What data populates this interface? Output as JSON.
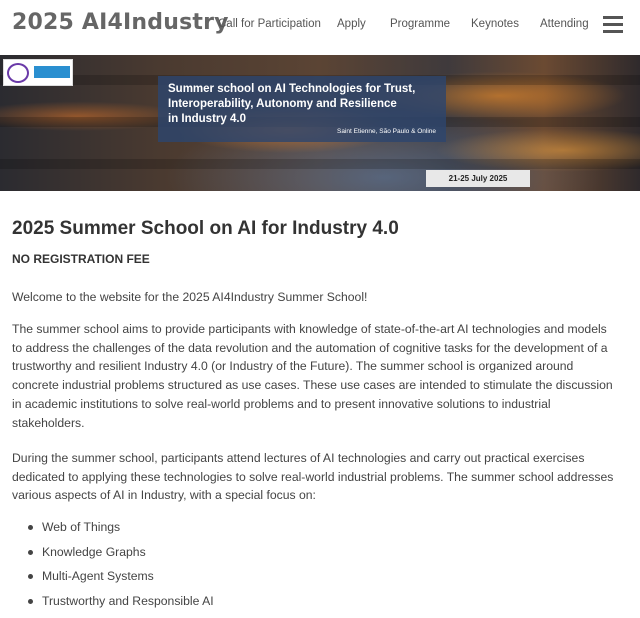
{
  "header": {
    "site_title": "2025 AI4Industry",
    "nav": [
      {
        "label": "Call for Participation"
      },
      {
        "label": "Apply"
      },
      {
        "label": "Programme"
      },
      {
        "label": "Keynotes"
      },
      {
        "label": "Attending"
      }
    ],
    "menu_icon": "hamburger-menu-icon"
  },
  "banner": {
    "title_lines": [
      "Summer school on AI Technologies for Trust,",
      "Interoperability, Autonomy and Resilience",
      "in Industry 4.0"
    ],
    "locations": "Saint Etienne, São Paulo & Online",
    "dates": "21-25 July 2025"
  },
  "main": {
    "title": "2025 Summer School on AI for Industry 4.0",
    "fee_notice": "NO REGISTRATION FEE",
    "welcome": "Welcome to the website for the 2025 AI4Industry Summer School!",
    "paragraph1_lines": [
      "The summer school aims to provide participants with knowledge of state-of-the-art AI technologies and models",
      "to address the challenges of the data revolution and the automation of cognitive tasks for the development of a",
      "trustworthy and resilient Industry 4.0 (or Industry of the Future). The summer school is organized around",
      "concrete industrial problems structured as use cases. These use cases are intended to stimulate the discussion",
      "in academic institutions to solve real-world problems and to present innovative solutions to industrial",
      "stakeholders."
    ],
    "paragraph2_lines": [
      "During the summer school, participants attend lectures of AI technologies and carry out practical exercises",
      "dedicated to applying these technologies to solve real-world industrial problems. The summer school addresses",
      "various aspects of AI in Industry, with a special focus on:"
    ],
    "focus_topics": [
      "Web of Things",
      "Knowledge Graphs",
      "Multi-Agent Systems",
      "Trustworthy and Responsible AI"
    ]
  }
}
